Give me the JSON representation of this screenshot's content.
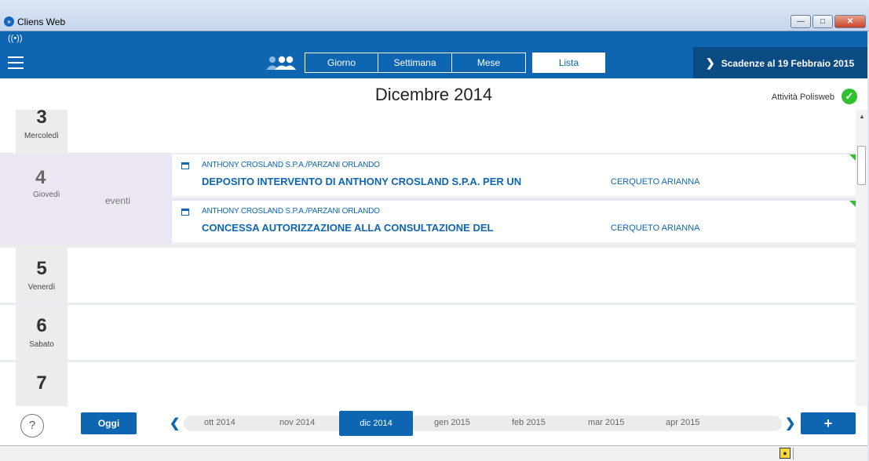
{
  "window": {
    "title": "Cliens Web",
    "logo": "»"
  },
  "navbar": {
    "tabs": [
      {
        "label": "Giorno",
        "active": false
      },
      {
        "label": "Settimana",
        "active": false
      },
      {
        "label": "Mese",
        "active": false
      },
      {
        "label": "Lista",
        "active": true
      }
    ],
    "deadline_label": "Scadenze al 19 Febbraio 2015"
  },
  "header": {
    "month_title": "Dicembre 2014",
    "polisweb_label": "Attività Polisweb"
  },
  "days": [
    {
      "number": "3",
      "name": "Mercoledì"
    },
    {
      "number": "4",
      "name": "Giovedì",
      "events_label": "eventi"
    },
    {
      "number": "5",
      "name": "Venerdì"
    },
    {
      "number": "6",
      "name": "Sabato"
    },
    {
      "number": "7",
      "name": ""
    }
  ],
  "events": [
    {
      "parties": "ANTHONY CROSLAND S.P.A./PARZANI ORLANDO",
      "title": "DEPOSITO INTERVENTO DI ANTHONY CROSLAND S.P.A. PER UN",
      "person": "CERQUETO ARIANNA"
    },
    {
      "parties": "ANTHONY CROSLAND S.P.A./PARZANI ORLANDO",
      "title": "CONCESSA AUTORIZZAZIONE ALLA CONSULTAZIONE DEL",
      "person": "CERQUETO ARIANNA"
    }
  ],
  "footer": {
    "help_label": "?",
    "today_label": "Oggi",
    "months": [
      "ott 2014",
      "nov 2014",
      "dic 2014",
      "gen 2015",
      "feb 2015",
      "mar 2015",
      "apr 2015"
    ],
    "add_label": "+"
  },
  "colors": {
    "primary": "#0e65b1",
    "dark": "#0a4b84",
    "success": "#2ec02e",
    "highlight_day": "#ece6f2"
  }
}
